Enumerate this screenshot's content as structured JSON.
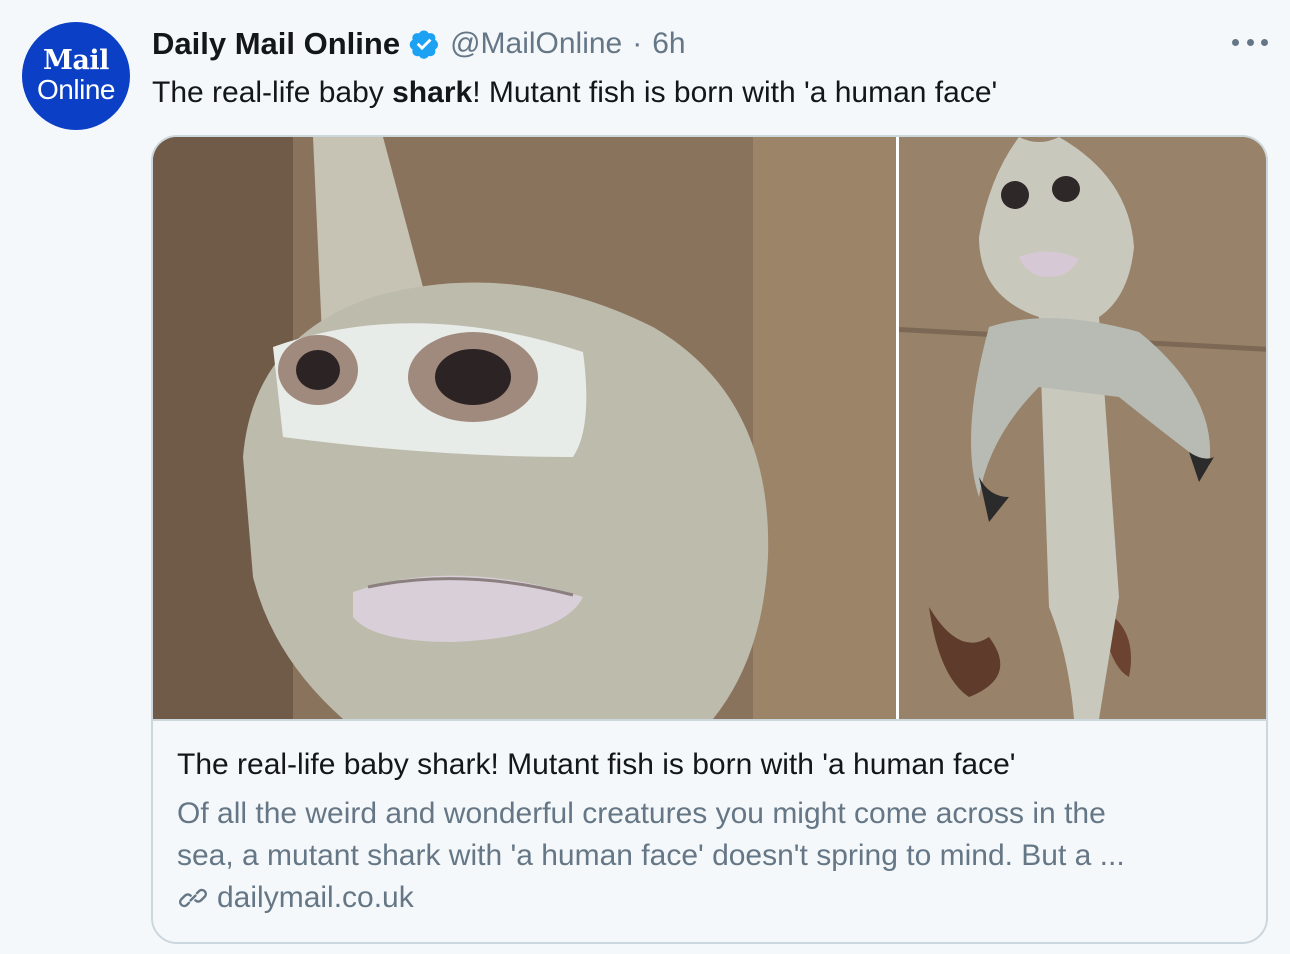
{
  "tweet": {
    "author_name": "Daily Mail Online",
    "author_handle": "@MailOnline",
    "separator": "·",
    "time": "6h",
    "text_before": "The real-life baby ",
    "text_bold": "shark",
    "text_after": "! Mutant fish is born with 'a human face'"
  },
  "avatar": {
    "line1": "Mail",
    "line2": "Online",
    "color": "#0a3fc6"
  },
  "card": {
    "title": "The real-life baby shark! Mutant fish is born with 'a human face'",
    "description_line1": "Of all the weird and wonderful creatures you might come across in the",
    "description_line2": "sea, a mutant shark with 'a human face' doesn't spring to mind. But a ...",
    "domain": "dailymail.co.uk",
    "images": [
      {
        "icon": "shark-face-closeup-photo"
      },
      {
        "icon": "shark-full-body-photo"
      }
    ]
  },
  "icons": {
    "verified": "verified-badge-icon",
    "more": "more-options-icon",
    "link": "link-icon"
  },
  "colors": {
    "accent": "#1da1f2",
    "secondary_text": "#657786",
    "border": "#ccd6dd",
    "background": "#f5f8fa"
  }
}
